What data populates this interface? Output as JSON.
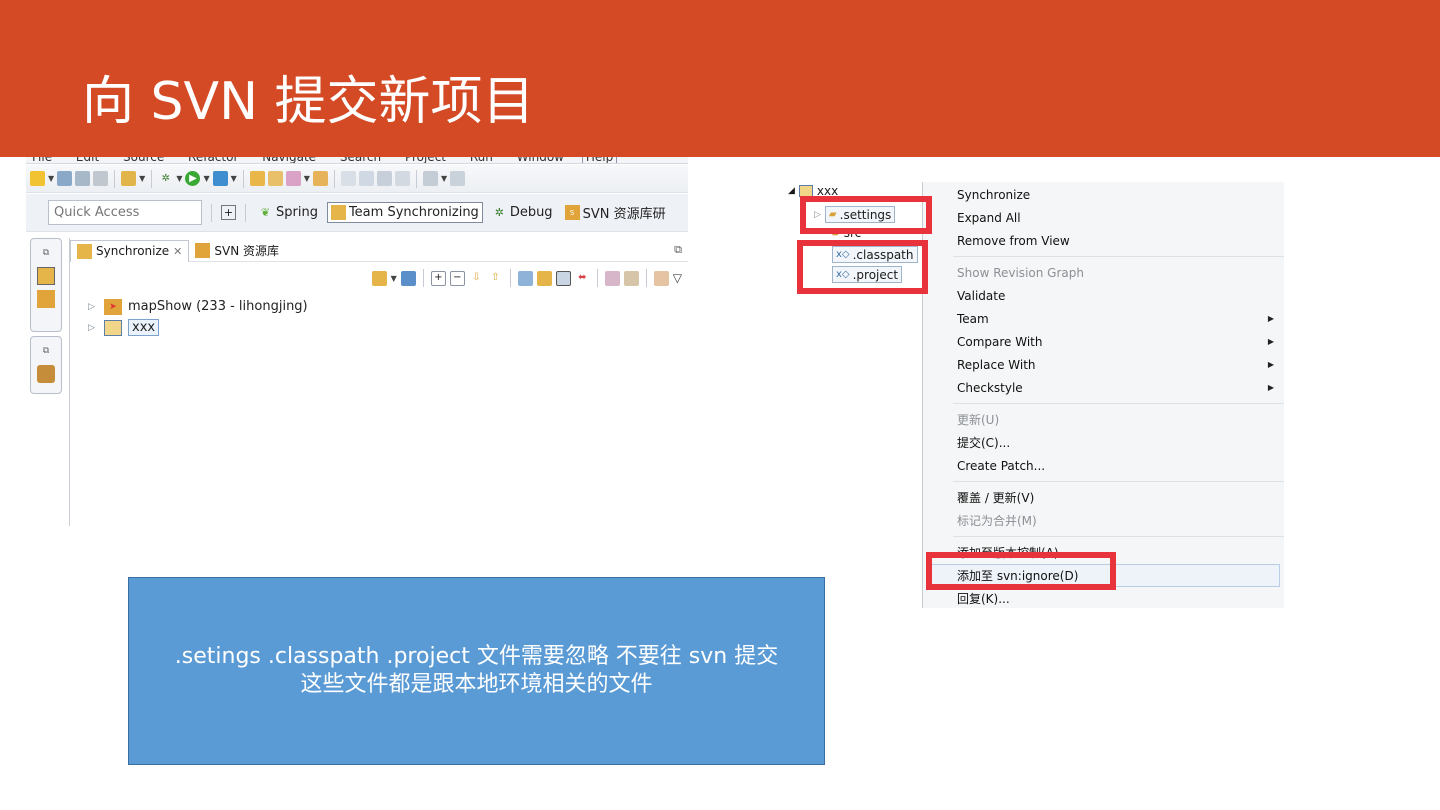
{
  "slide": {
    "title": "向 SVN 提交新项目",
    "callout_line1": ".setings .classpath .project  文件需要忽略 不要往 svn 提交",
    "callout_line2": "这些文件都是跟本地环境相关的文件",
    "colors": {
      "banner": "#d44a25",
      "callout": "#5b9bd5",
      "highlight": "#e8333c"
    }
  },
  "eclipse": {
    "menubar": [
      "File",
      "Edit",
      "Source",
      "Refactor",
      "Navigate",
      "Search",
      "Project",
      "Run",
      "Window",
      "Help"
    ],
    "quick_access_placeholder": "Quick Access",
    "perspectives": {
      "spring": "Spring",
      "team": "Team Synchronizing",
      "debug": "Debug",
      "svn": "SVN 资源库研"
    },
    "tabs": {
      "synchronize": "Synchronize",
      "svn_repo": "SVN 资源库"
    },
    "tree": [
      {
        "label": "mapShow (233 - lihongjing)"
      },
      {
        "label": "xxx"
      }
    ]
  },
  "explorer": {
    "root": "xxx",
    "items": {
      "settings": ".settings",
      "src": "src",
      "classpath": ".classpath",
      "project": ".project"
    }
  },
  "context_menu": {
    "synchronize": "Synchronize",
    "expand_all": "Expand All",
    "remove_from_view": "Remove from View",
    "show_revision_graph": "Show Revision Graph",
    "validate": "Validate",
    "team": "Team",
    "compare_with": "Compare With",
    "replace_with": "Replace With",
    "checkstyle": "Checkstyle",
    "update": "更新(U)",
    "commit": "提交(C)...",
    "create_patch": "Create Patch...",
    "override_update": "覆盖 / 更新(V)",
    "mark_merged": "标记为合并(M)",
    "add_version_control": "添加至版本控制(A)",
    "add_svn_ignore": "添加至 svn:ignore(D)",
    "revert": "回复(K)..."
  }
}
